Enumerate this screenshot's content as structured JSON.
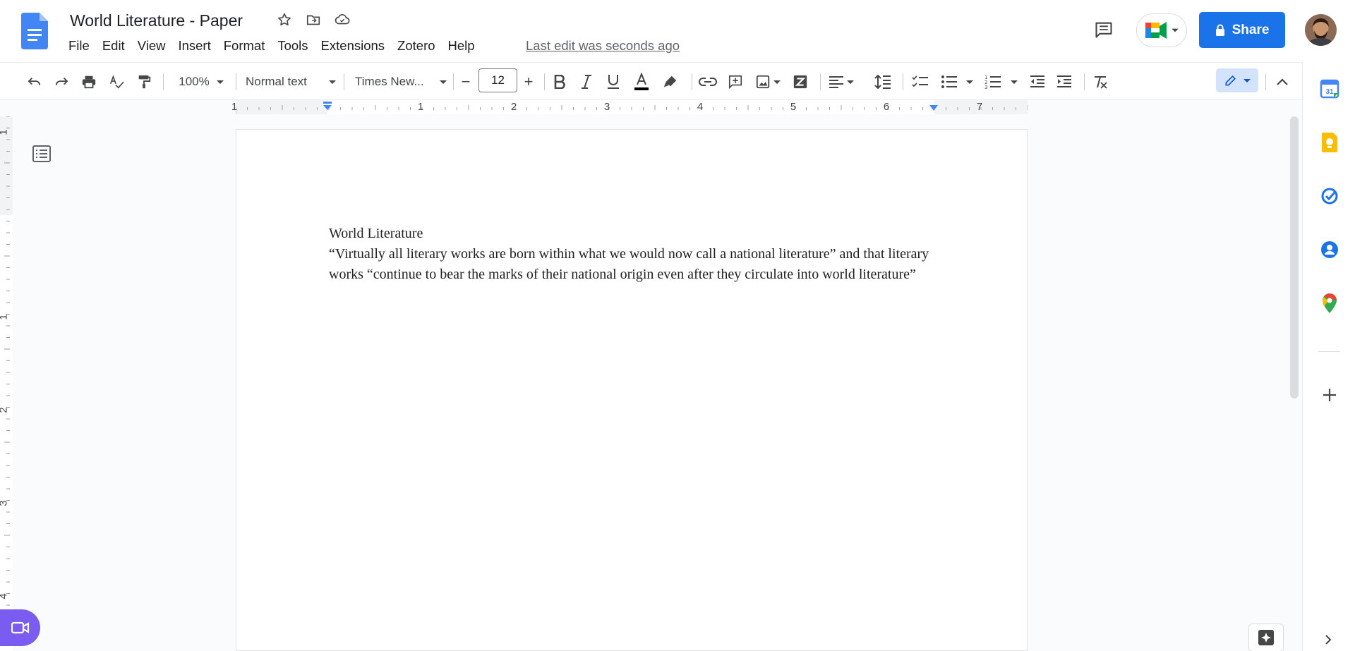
{
  "document": {
    "title": "World Literature - Paper",
    "last_edit": "Last edit was seconds ago",
    "heading": "World Literature",
    "paragraph": "“Virtually all literary works are born within what we would now call a national literature” and that literary works “continue to bear the marks of their national origin even after they circulate into world literature”"
  },
  "menu": [
    "File",
    "Edit",
    "View",
    "Insert",
    "Format",
    "Tools",
    "Extensions",
    "Zotero",
    "Help"
  ],
  "header": {
    "share_label": "Share"
  },
  "toolbar": {
    "zoom": "100%",
    "style": "Normal text",
    "font": "Times New...",
    "font_size": "12",
    "minus": "−",
    "plus": "+"
  },
  "ruler": {
    "h_labels": [
      "1",
      "1",
      "2",
      "3",
      "4",
      "5",
      "6",
      "7"
    ],
    "v_labels": [
      "1",
      "1",
      "2",
      "3",
      "4"
    ]
  },
  "icons": {
    "docs_logo": "google-docs-icon",
    "calendar_day": "31",
    "accent": "#1a73e8"
  }
}
